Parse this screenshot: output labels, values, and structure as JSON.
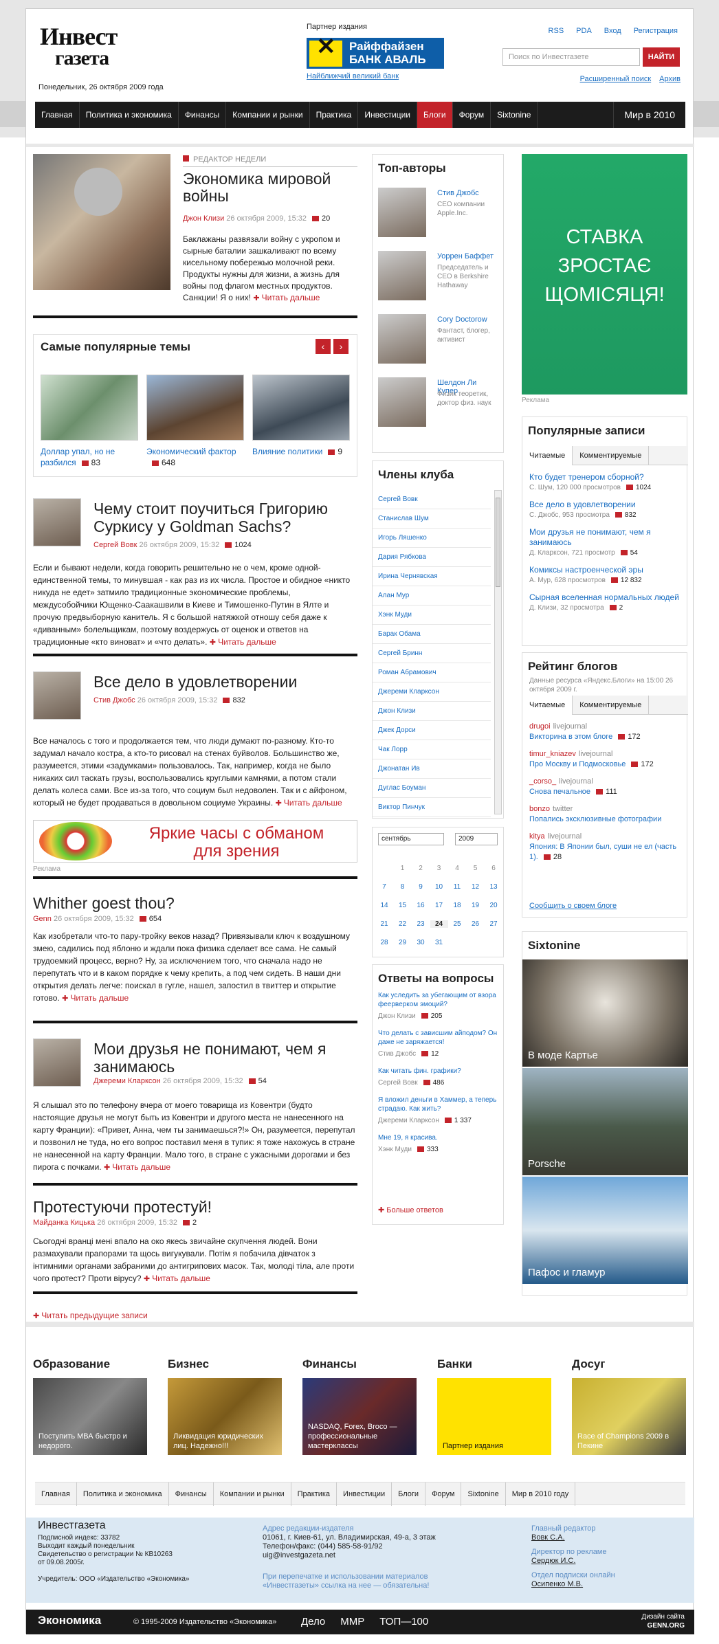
{
  "header": {
    "logo_line1": "Инвест",
    "logo_line2": "газета",
    "date": "Понедельник, 26 октября 2009 года",
    "partner_label": "Партнер издания",
    "bank_line1": "Райффайзен",
    "bank_line2": "БАНК АВАЛЬ",
    "bank_link": "Найближчий великий банк",
    "links": [
      "RSS",
      "PDA",
      "Вход",
      "Регистрация"
    ],
    "search_placeholder": "Поиск по Инвестгазете",
    "search_button": "НАЙТИ",
    "sublinks": [
      "Расширенный поиск",
      "Архив"
    ]
  },
  "nav": {
    "items": [
      "Главная",
      "Политика и экономика",
      "Финансы",
      "Компании и рынки",
      "Практика",
      "Инвестиции",
      "Блоги",
      "Форум",
      "Sixtonine"
    ],
    "active": "Блоги",
    "right": "Мир в 2010"
  },
  "lead": {
    "label": "РЕДАКТОР НЕДЕЛИ",
    "title": "Экономика мировой войны",
    "author": "Джон Клизи",
    "date": "26 октября 2009, 15:32",
    "comments": "20",
    "text": "Баклажаны развязали войну с укропом и сырные баталии зашкаливают по всему кисельному побережью молочной реки. Продукты нужны для жизни, а жизнь для войны под флагом местных продуктов. Санкции! Я о них!",
    "more": "Читать дальше"
  },
  "popular": {
    "title": "Самые популярные темы",
    "items": [
      {
        "label": "Доллар упал, но не разбился",
        "count": "83"
      },
      {
        "label": "Экономический фактор",
        "count": "648"
      },
      {
        "label": "Влияние политики",
        "count": "9"
      }
    ]
  },
  "articles": [
    {
      "title": "Чему стоит поучиться Григорию Суркису у Goldman Sachs?",
      "author": "Сергей Вовк",
      "date": "26 октября 2009, 15:32",
      "comments": "1024",
      "text": "Если и бывают недели, когда говорить решительно не о чем, кроме одной-единственной темы, то минувшая - как раз из их числа. Простое и обидное «никто никуда не едет» затмило традиционные экономические проблемы, междусобойчики Ющенко-Саакашвили в Киеве и Тимошенко-Путин в Ялте и прочую предвыборную канитель. Я с большой натяжкой отношу себя даже к «диванным» болельщикам, поэтому воздержусь от оценок и ответов на традиционные «кто виноват» и «что делать».",
      "more": "Читать дальше"
    },
    {
      "title": "Все дело в удовлетворении",
      "author": "Стив Джобс",
      "date": "26 октября 2009, 15:32",
      "comments": "832",
      "text": "Все началось с того и продолжается тем, что люди думают по-разному. Кто-то задумал начало костра, а кто-то рисовал на стенах буйволов. Большинство же, разумеется, этими «задумками» пользовалось. Так, например, когда не было никаких сил таскать грузы, воспользовались круглыми камнями, а потом стали делать колеса сами. Все из-за того, что социум был недоволен. Так и с айфоном, который не будет продаваться в довольном социуме Украины.",
      "more": "Читать дальше"
    },
    {
      "title": "Whither goest thou?",
      "author": "Genn",
      "date": "26 октября 2009, 15:32",
      "comments": "654",
      "text": "Как изобретали что-то пару-тройку веков назад? Привязывали ключ к воздушному змею, садились под яблоню и ждали пока физика сделает все сама. Не самый трудоемкий процесс, верно? Ну, за исключением того, что сначала надо не перепутать что и в каком порядке к чему крепить, а под чем сидеть. В наши дни открытия делать легче: поискал в гугле, нашел, запостил в твиттер и открытие готово.",
      "more": "Читать дальше"
    },
    {
      "title": "Мои друзья не понимают, чем я занимаюсь",
      "author": "Джереми Кларксон",
      "date": "26 октября 2009, 15:32",
      "comments": "54",
      "text": "Я слышал это по телефону вчера от моего товарища из Ковентри (будто настоящие друзья не могут быть из Ковентри и другого места не нанесенного на карту Франции): «Привет, Анна, чем ты занимаешься?!» Он, разумеется, перепутал и позвонил не туда, но его вопрос поставил меня в тупик: я тоже нахожусь в стране не нанесенной на карту Франции. Мало того, в стране с ужасными дорогами и без пирога с почками.",
      "more": "Читать дальше"
    },
    {
      "title": "Протестуючи протестуй!",
      "author": "Майданка Кицька",
      "date": "26 октября 2009, 15:32",
      "comments": "2",
      "text": "Сьогодні вранці мені впало на око якесь звичайне скупчення людей. Вони размахували прапорами та щось вигукували. Потім я побачила дівчаток з інтимними органами забраними до антигрипових масок. Так, молоді тіла, але проти чого протест? Проти вірусу?",
      "more": "Читать дальше"
    }
  ],
  "ad1": {
    "line1": "Яркие часы с обманом",
    "line2": "для зрения",
    "label": "Реклама"
  },
  "prev": "Читать предыдущие записи",
  "topauthors": {
    "title": "Топ-авторы",
    "items": [
      {
        "name": "Стив Джобс",
        "desc": "CEO компании Apple.Inc."
      },
      {
        "name": "Уоррен Баффет",
        "desc": "Председатель и CEO в Berkshire Hathaway"
      },
      {
        "name": "Cory Doctorow",
        "desc": "Фантаст, блогер, активист"
      },
      {
        "name": "Шелдон Ли Купер",
        "desc": "Физик теоретик, доктор физ. наук"
      }
    ]
  },
  "club": {
    "title": "Члены клуба",
    "members": [
      "Сергей Вовк",
      "Станислав Шум",
      "Игорь Ляшенко",
      "Дария Рябкова",
      "Ирина Чернявская",
      "Алан Мур",
      "Хэнк Муди",
      "Барак Обама",
      "Сергей Бринн",
      "Роман Абрамович",
      "Джереми Кларксон",
      "Джон Клизи",
      "Джек Дорси",
      "Чак Лорр",
      "Джонатан Ив",
      "Дуглас Боуман",
      "Виктор Пинчук"
    ]
  },
  "calendar": {
    "month": "сентябрь",
    "year": "2009",
    "weeks": [
      [
        "",
        "",
        "1",
        "2",
        "3",
        "4",
        "5",
        "6"
      ],
      [
        "7",
        "8",
        "9",
        "10",
        "11",
        "12",
        "13"
      ],
      [
        "14",
        "15",
        "16",
        "17",
        "18",
        "19",
        "20"
      ],
      [
        "21",
        "22",
        "23",
        "24",
        "25",
        "26",
        "27"
      ],
      [
        "28",
        "29",
        "30",
        "31"
      ]
    ]
  },
  "answers": {
    "title": "Ответы на вопросы",
    "items": [
      {
        "q": "Как уследить за убегающим от взора феерверком эмоций?",
        "a": "Джон Клизи",
        "n": "205"
      },
      {
        "q": "Что делать с зависшим айподом? Он даже не заряжается!",
        "a": "Стив Джобс",
        "n": "12"
      },
      {
        "q": "Как читать фин. графики?",
        "a": "Сергей Вовк",
        "n": "486"
      },
      {
        "q": "Я вложил деньги в Хаммер, а теперь страдаю. Как жить?",
        "a": "Джереми Кларксон",
        "n": "1 337"
      },
      {
        "q": "Мне 19, я красива.",
        "a": "Хэнк Муди",
        "n": "333"
      }
    ],
    "more": "Больше ответов"
  },
  "bigad": {
    "line1": "СТАВКА",
    "line2": "ЗРОСТАЄ",
    "line3": "ЩОМІСЯЦЯ!",
    "label": "Реклама"
  },
  "popposts": {
    "title": "Популярные записи",
    "tabs": [
      "Читаемые",
      "Комментируемые"
    ],
    "items": [
      {
        "t": "Кто будет тренером сборной?",
        "m": "С. Шум, 120 000 просмотров",
        "n": "1024"
      },
      {
        "t": "Все дело в удовлетворении",
        "m": "С. Джобс, 953 просмотра",
        "n": "832"
      },
      {
        "t": "Мои друзья не понимают, чем я занимаюсь",
        "m": "Д. Кларксон, 721 просмотр",
        "n": "54"
      },
      {
        "t": "Комиксы настроенческой эры",
        "m": "А. Мур, 628 просмотров",
        "n": "12 832"
      },
      {
        "t": "Сырная вселенная нормальных людей",
        "m": "Д. Клизи, 32 просмотра",
        "n": "2"
      }
    ]
  },
  "ratings": {
    "title": "Рейтинг блогов",
    "sub": "Данные ресурса «Яндекс.Блоги» на 15:00 26 октября 2009 г.",
    "tabs": [
      "Читаемые",
      "Комментируемые"
    ],
    "items": [
      {
        "u": "drugoi",
        "s": "livejournal",
        "t": "Викторина в этом блоге",
        "n": "172"
      },
      {
        "u": "timur_kniazev",
        "s": "livejournal",
        "t": "Про Москву и Подмосковье",
        "n": "172"
      },
      {
        "u": "_corso_",
        "s": "livejournal",
        "t": "Снова печальное",
        "n": "111"
      },
      {
        "u": "bonzo",
        "s": "twitter",
        "t": "Попались эксклюзивные фотографии",
        "n": ""
      },
      {
        "u": "kitya",
        "s": "livejournal",
        "t": "Япония: В Японии был, суши не ел (часть 1).",
        "n": "28"
      }
    ],
    "footer": "Сообщить о своем блоге"
  },
  "sixtonine": {
    "title": "Sixtonine",
    "items": [
      "В моде Картье",
      "Porsche",
      "Пафос и гламур"
    ]
  },
  "categories": [
    {
      "title": "Образование",
      "cap": "Поступить МВА быстро и недорого."
    },
    {
      "title": "Бизнес",
      "cap": "Ликвидация юридических лиц. Надежно!!!"
    },
    {
      "title": "Финансы",
      "cap": "NASDAQ, Forex, Broco — профессиональные мастерклассы"
    },
    {
      "title": "Банки",
      "cap": "Партнер издания"
    },
    {
      "title": "Досуг",
      "cap": "Race of Champions 2009 в Пекине"
    }
  ],
  "bottomnav": [
    "Главная",
    "Политика и экономика",
    "Финансы",
    "Компании и рынки",
    "Практика",
    "Инвестиции",
    "Блоги",
    "Форум",
    "Sixtonine",
    "Мир в 2010 году"
  ],
  "footer": {
    "name": "Инвестгазета",
    "info": [
      "Подписной индекс: 33782",
      "Выходит каждый понедельник",
      "Свидетельство о регистрации № КВ10263",
      "от 09.08.2005г.",
      "",
      "Учредитель: ООО «Издательство «Экономика»"
    ],
    "addr_h": "Адрес редакции-издателя",
    "addr": [
      "01061, г. Киев-61, ул. Владимирская, 49-а, 3 этаж",
      "Телефон/факс: (044) 585-58-91/92",
      "uig@investgazeta.net"
    ],
    "reprint": "При перепечатке и использовании материалов «Инвестгазеты» ссылка на нее — обязательна!",
    "staff": [
      {
        "h": "Главный редактор",
        "v": "Вовк С.А."
      },
      {
        "h": "Директор по рекламе",
        "v": "Сердюк И.С."
      },
      {
        "h": "Отдел подписки онлайн",
        "v": "Осипенко М.В."
      }
    ],
    "bar_logo": "Экономика",
    "copy": "© 1995-2009 Издательство «Экономика»",
    "bar_links": [
      "Дело",
      "MMP",
      "ТОП—100"
    ],
    "design1": "Дизайн сайта",
    "design2": "GENN.ORG"
  },
  "colors": {
    "accent": "#c3232a",
    "link": "#1a6ec2",
    "nav": "#1c1c1c",
    "ad": "#23a968",
    "footer": "#dbe8f3"
  }
}
